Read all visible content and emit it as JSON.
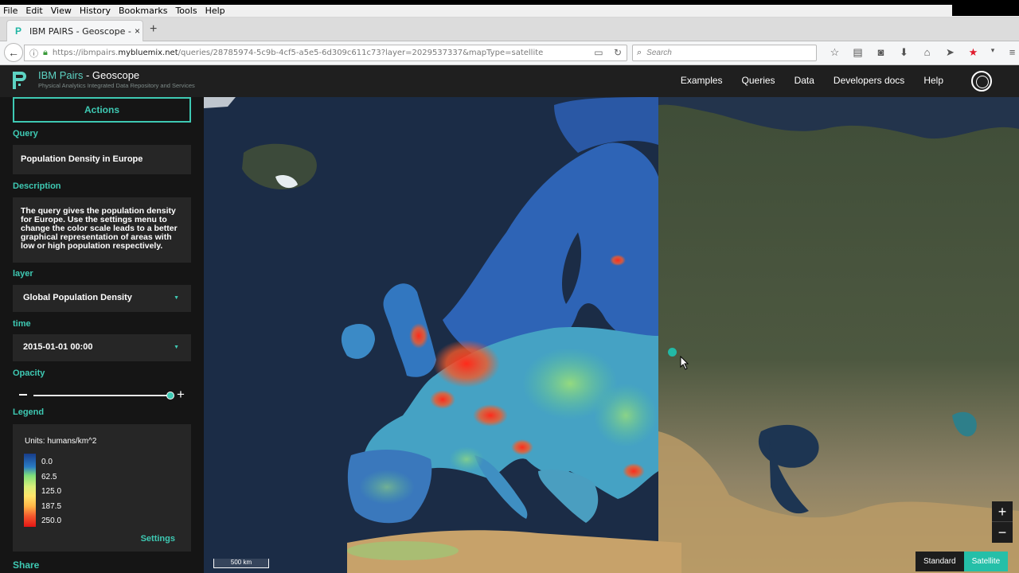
{
  "browser": {
    "menu": [
      "File",
      "Edit",
      "View",
      "History",
      "Bookmarks",
      "Tools",
      "Help"
    ],
    "tab_title": "IBM PAIRS - Geoscope - Po...",
    "url_prefix": "https://ibmpairs.",
    "url_host": "mybluemix.net",
    "url_rest": "/queries/28785974-5c9b-4cf5-a5e5-6d309c611c73?layer=2029537337&mapType=satellite",
    "search_placeholder": "Search"
  },
  "app": {
    "brand": "IBM Pairs",
    "brand_sub": " - Geoscope",
    "tagline": "Physical Analytics Integrated Data Repository and Services",
    "nav": [
      "Examples",
      "Queries",
      "Data",
      "Developers docs",
      "Help"
    ]
  },
  "sidebar": {
    "actions_label": "Actions",
    "query_label": "Query",
    "query_value": "Population Density in Europe",
    "description_label": "Description",
    "description_value": "The query gives the population density for Europe. Use the settings menu to change the color scale leads to a better graphical representation of areas with low or high population respectively.",
    "layer_label": "layer",
    "layer_value": "Global Population Density",
    "time_label": "time",
    "time_value": "2015-01-01 00:00",
    "opacity_label": "Opacity",
    "opacity_value": 0.98,
    "legend_label": "Legend",
    "legend_units": "Units: humans/km^2",
    "legend_values": [
      "0.0",
      "62.5",
      "125.0",
      "187.5",
      "250.0"
    ],
    "settings_label": "Settings",
    "share_label": "Share"
  },
  "map": {
    "scale_label": "500 km",
    "zoom_in": "+",
    "zoom_out": "−",
    "basemap_standard": "Standard",
    "basemap_satellite": "Satellite",
    "active_basemap": "Satellite"
  },
  "colors": {
    "accent": "#3ec9b3",
    "header_bg": "#1f1f1f",
    "sidebar_bg": "#151515"
  }
}
